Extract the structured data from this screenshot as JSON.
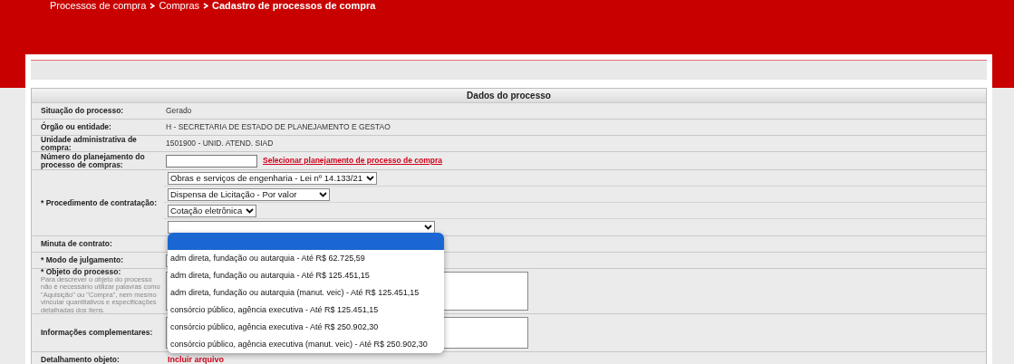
{
  "breadcrumb": [
    {
      "label": "Processos de compra",
      "current": false
    },
    {
      "label": "Compras",
      "current": false
    },
    {
      "label": "Cadastro de processos de compra",
      "current": true
    }
  ],
  "section_title": "Dados do processo",
  "fields": [
    {
      "kind": "text",
      "label": "Situação do processo:",
      "value": "Gerado"
    },
    {
      "kind": "text",
      "label": "Órgão ou entidade:",
      "value": "H - SECRETARIA DE ESTADO DE PLANEJAMENTO E GESTAO"
    },
    {
      "kind": "text",
      "label": "Unidade administrativa de compra:",
      "value": "1501900 - UNID. ATEND. SIAD"
    },
    {
      "kind": "input",
      "label": "Número do planejamento do processo de compras:",
      "link": "Selecionar planejamento de processo de compra"
    },
    {
      "kind": "selects",
      "label": "* Procedimento de contratação:",
      "selects": [
        {
          "value": "Obras e serviços de engenharia - Lei nº 14.133/21"
        },
        {
          "value": "Dispensa de Licitação - Por valor"
        },
        {
          "value": "Cotação eletrônica"
        },
        {
          "options": [
            {
              "selected": true
            },
            {
              "label": "adm direta, fundação ou autarquia - Até R$ 62.725,59",
              "selected": false
            },
            {
              "label": "adm direta, fundação ou autarquia - Até R$ 125.451,15",
              "selected": false
            },
            {
              "label": "adm direta, fundação ou autarquia (manut. veic) - Até R$ 125.451,15",
              "selected": false
            },
            {
              "label": "consórcio público, agência executiva - Até R$ 125.451,15",
              "selected": false
            },
            {
              "label": "consórcio público, agência executiva - Até R$ 250.902,30",
              "selected": false
            },
            {
              "label": "consórcio público, agência executiva (manut. veic) - Até R$ 250.902,30",
              "selected": false
            }
          ]
        }
      ]
    },
    {
      "kind": "blank",
      "label": "Minuta de contrato:"
    },
    {
      "kind": "select",
      "label": "* Modo de julgamento:"
    },
    {
      "kind": "textarea",
      "label": "* Objeto do processo:",
      "hint": "Para descrever o objeto do processo não é necessário utilizar palavras como \"Aquisição\" ou \"Compra\", nem mesmo vincular quantitativos e especificações detalhadas dos itens."
    },
    {
      "kind": "textarea",
      "label": "Informações complementares:"
    },
    {
      "kind": "link",
      "label": "Detalhamento objeto:",
      "link": "Incluir arquivo"
    }
  ]
}
